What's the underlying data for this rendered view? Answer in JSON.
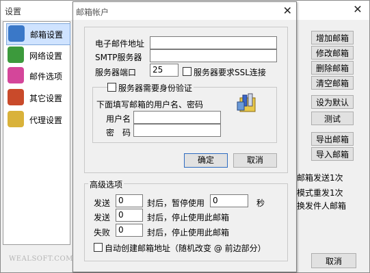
{
  "settings_window": {
    "title": "设置",
    "close_symbol": "✕",
    "sidebar": [
      {
        "label": "邮箱设置",
        "icon": "mailbox-icon",
        "color": "#3a78c8"
      },
      {
        "label": "网络设置",
        "icon": "network-icon",
        "color": "#3c9a3c"
      },
      {
        "label": "邮件选项",
        "icon": "mail-options-icon",
        "color": "#d4469a"
      },
      {
        "label": "其它设置",
        "icon": "other-settings-icon",
        "color": "#c94a2a"
      },
      {
        "label": "代理设置",
        "icon": "proxy-icon",
        "color": "#d9b23a"
      }
    ],
    "logo_text": "WEALSOFT.COM",
    "buttons": [
      "增加邮箱",
      "修改邮箱",
      "删除邮箱",
      "清空邮箱",
      "设为默认",
      "测试",
      "导出邮箱",
      "导入邮箱"
    ],
    "partial_texts": [
      "邮箱发送1次",
      "模式重发1次",
      "换发件人邮箱"
    ],
    "cancel": "取消"
  },
  "dialog": {
    "title": "邮箱帐户",
    "close_symbol": "✕",
    "email_label": "电子邮件地址",
    "email_value": "",
    "smtp_label": "SMTP服务器",
    "smtp_value": "",
    "port_label": "服务器端口",
    "port_value": "25",
    "ssl_label": "服务器要求SSL连接",
    "auth_label": "服务器需要身份验证",
    "auth_hint": "下面填写邮箱的用户名、密码",
    "user_label": "用户名",
    "user_value": "",
    "pass_label": "密　码",
    "pass_value": "",
    "ok": "确定",
    "cancel": "取消",
    "advanced": {
      "title": "高级选项",
      "row1": {
        "prefix": "发送",
        "value": "0",
        "mid": "封后，暂停使用",
        "value2": "0",
        "suffix": "秒"
      },
      "row2": {
        "prefix": "发送",
        "value": "0",
        "mid": "封后，停止使用此邮箱"
      },
      "row3": {
        "prefix": "失败",
        "value": "0",
        "mid": "封后，停止使用此邮箱"
      },
      "auto_create": "自动创建邮箱地址（随机改变 @ 前边部分）"
    }
  }
}
